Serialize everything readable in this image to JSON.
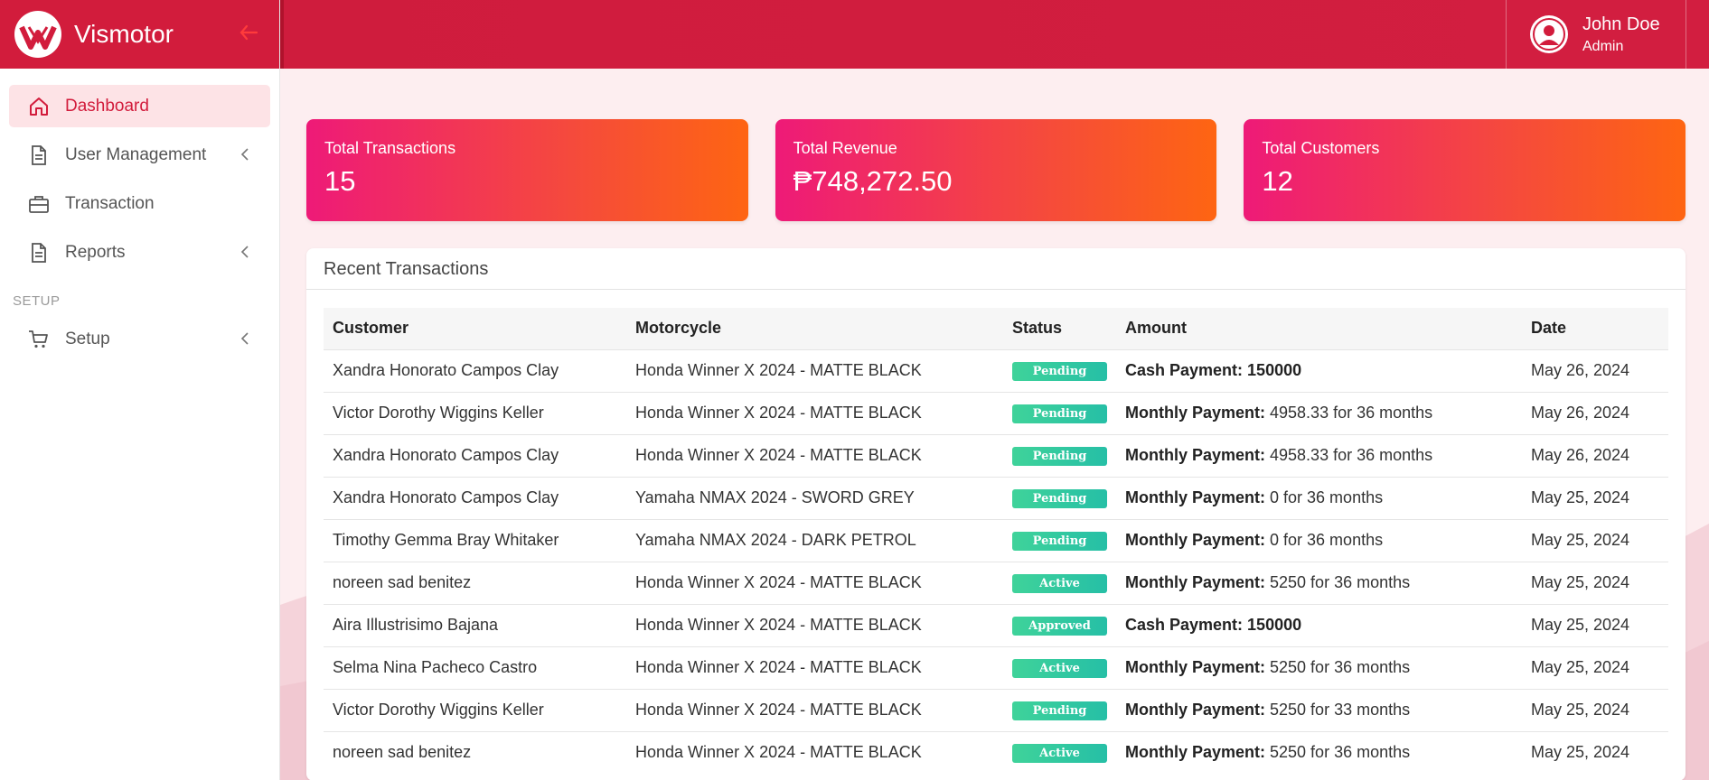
{
  "brand": {
    "name": "Vismotor"
  },
  "sidebar": {
    "items": [
      {
        "label": "Dashboard",
        "icon": "home-icon",
        "active": true,
        "has_submenu": false
      },
      {
        "label": "User Management",
        "icon": "document-icon",
        "active": false,
        "has_submenu": true
      },
      {
        "label": "Transaction",
        "icon": "briefcase-icon",
        "active": false,
        "has_submenu": false
      },
      {
        "label": "Reports",
        "icon": "document-icon",
        "active": false,
        "has_submenu": true
      }
    ],
    "section_label": "SETUP",
    "setup_item": {
      "label": "Setup",
      "icon": "cart-icon",
      "has_submenu": true
    }
  },
  "user": {
    "name": "John Doe",
    "role": "Admin"
  },
  "stats": [
    {
      "label": "Total Transactions",
      "value": "15"
    },
    {
      "label": "Total Revenue",
      "value": "₱748,272.50"
    },
    {
      "label": "Total Customers",
      "value": "12"
    }
  ],
  "recent": {
    "title": "Recent Transactions",
    "columns": [
      "Customer",
      "Motorcycle",
      "Status",
      "Amount",
      "Date"
    ],
    "rows": [
      {
        "customer": "Xandra Honorato Campos Clay",
        "motorcycle": "Honda Winner X 2024 - MATTE BLACK",
        "status": "Pending",
        "amount_label": "Cash Payment: 150000",
        "amount_rest": "",
        "date": "May 26, 2024"
      },
      {
        "customer": "Victor Dorothy Wiggins Keller",
        "motorcycle": "Honda Winner X 2024 - MATTE BLACK",
        "status": "Pending",
        "amount_label": "Monthly Payment:",
        "amount_rest": " 4958.33 for 36 months",
        "date": "May 26, 2024"
      },
      {
        "customer": "Xandra Honorato Campos Clay",
        "motorcycle": "Honda Winner X 2024 - MATTE BLACK",
        "status": "Pending",
        "amount_label": "Monthly Payment:",
        "amount_rest": " 4958.33 for 36 months",
        "date": "May 26, 2024"
      },
      {
        "customer": "Xandra Honorato Campos Clay",
        "motorcycle": "Yamaha NMAX 2024 - SWORD GREY",
        "status": "Pending",
        "amount_label": "Monthly Payment:",
        "amount_rest": " 0 for 36 months",
        "date": "May 25, 2024"
      },
      {
        "customer": "Timothy Gemma Bray Whitaker",
        "motorcycle": "Yamaha NMAX 2024 - DARK PETROL",
        "status": "Pending",
        "amount_label": "Monthly Payment:",
        "amount_rest": " 0 for 36 months",
        "date": "May 25, 2024"
      },
      {
        "customer": "noreen sad benitez",
        "motorcycle": "Honda Winner X 2024 - MATTE BLACK",
        "status": "Active",
        "amount_label": "Monthly Payment:",
        "amount_rest": " 5250 for 36 months",
        "date": "May 25, 2024"
      },
      {
        "customer": "Aira Illustrisimo Bajana",
        "motorcycle": "Honda Winner X 2024 - MATTE BLACK",
        "status": "Approved",
        "amount_label": "Cash Payment: 150000",
        "amount_rest": "",
        "date": "May 25, 2024"
      },
      {
        "customer": "Selma Nina Pacheco Castro",
        "motorcycle": "Honda Winner X 2024 - MATTE BLACK",
        "status": "Active",
        "amount_label": "Monthly Payment:",
        "amount_rest": " 5250 for 36 months",
        "date": "May 25, 2024"
      },
      {
        "customer": "Victor Dorothy Wiggins Keller",
        "motorcycle": "Honda Winner X 2024 - MATTE BLACK",
        "status": "Pending",
        "amount_label": "Monthly Payment:",
        "amount_rest": " 5250 for 33 months",
        "date": "May 25, 2024"
      },
      {
        "customer": "noreen sad benitez",
        "motorcycle": "Honda Winner X 2024 - MATTE BLACK",
        "status": "Active",
        "amount_label": "Monthly Payment:",
        "amount_rest": " 5250 for 36 months",
        "date": "May 25, 2024"
      }
    ]
  },
  "colors": {
    "brand": "#d21c3c",
    "active_bg": "#fde3e6",
    "badge": "#2ecc9a",
    "card_start": "#ee1a78",
    "card_end": "#fe6512"
  }
}
